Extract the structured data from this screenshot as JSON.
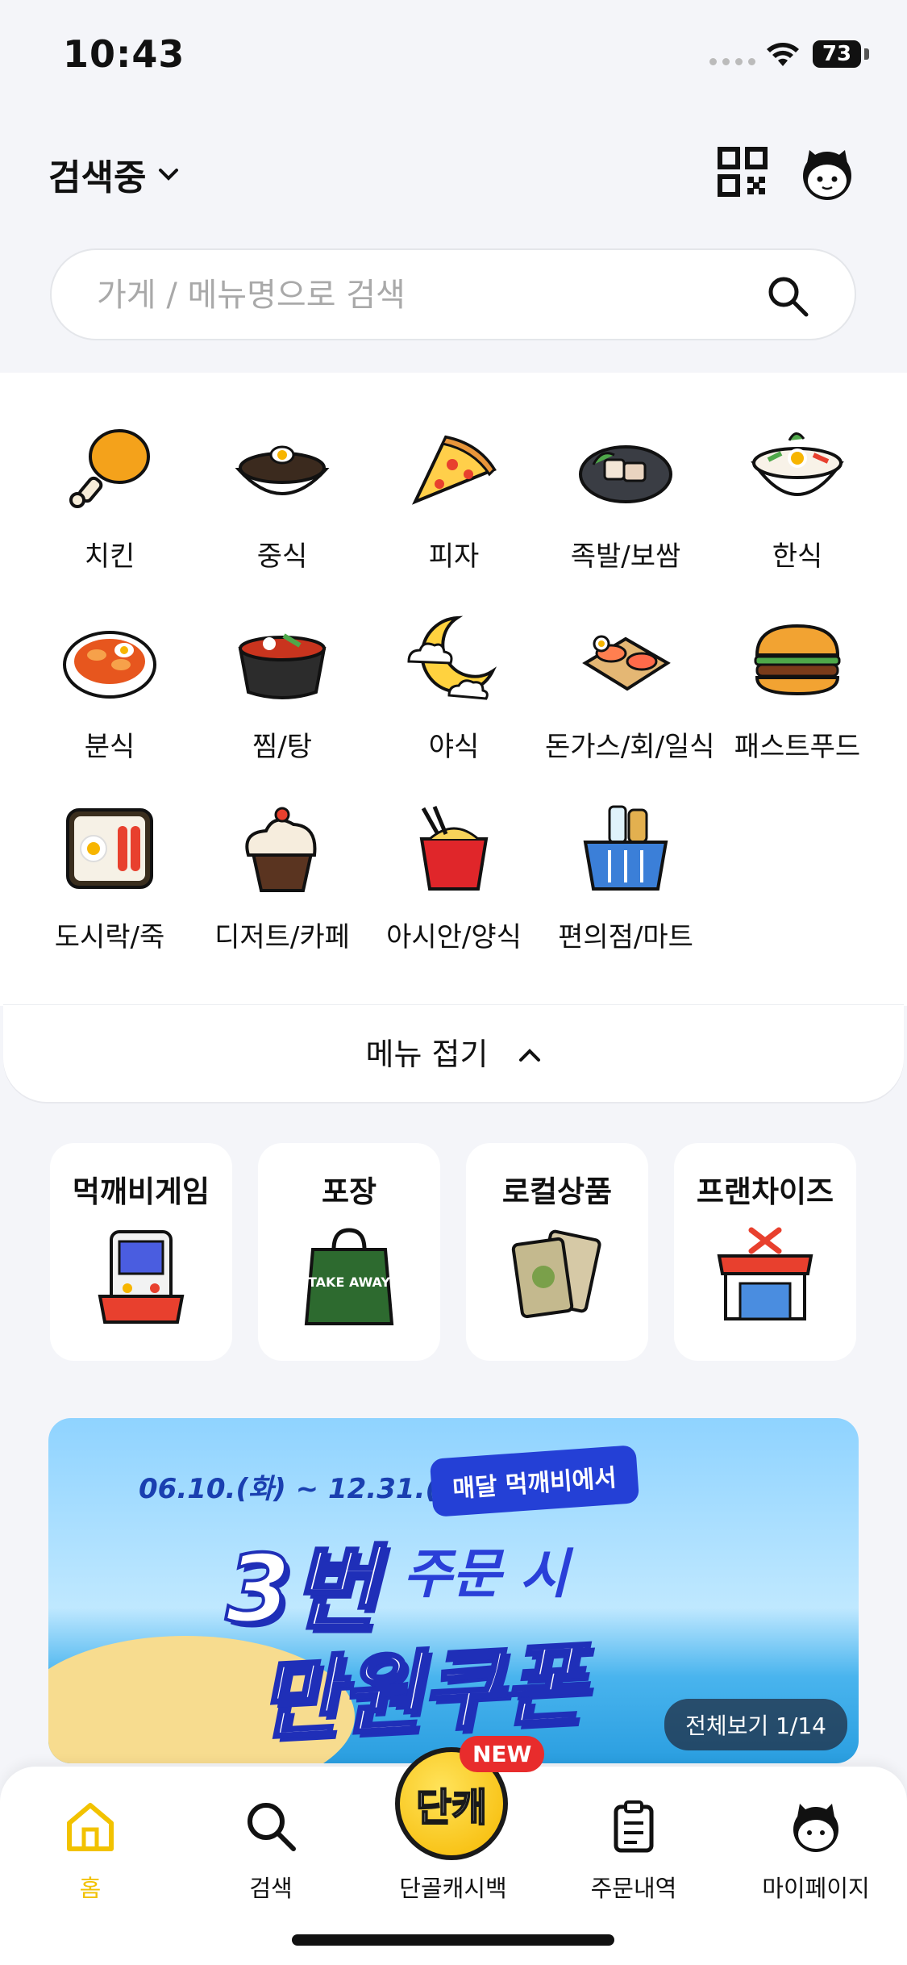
{
  "status": {
    "time": "10:43",
    "battery": "73"
  },
  "header": {
    "location": "검색중",
    "qr_icon": "qr-code-icon",
    "profile_icon": "character-face-icon"
  },
  "search": {
    "placeholder": "가게 / 메뉴명으로 검색"
  },
  "categories": [
    {
      "label": "치킨",
      "icon": "chicken-icon"
    },
    {
      "label": "중식",
      "icon": "jajangmyeon-icon"
    },
    {
      "label": "피자",
      "icon": "pizza-icon"
    },
    {
      "label": "족발/보쌈",
      "icon": "bossam-icon"
    },
    {
      "label": "한식",
      "icon": "bibimbap-icon"
    },
    {
      "label": "분식",
      "icon": "tteokbokki-icon"
    },
    {
      "label": "찜/탕",
      "icon": "stew-pot-icon"
    },
    {
      "label": "야식",
      "icon": "moon-icon"
    },
    {
      "label": "돈가스/회/일식",
      "icon": "sushi-icon"
    },
    {
      "label": "패스트푸드",
      "icon": "burger-icon"
    },
    {
      "label": "도시락/죽",
      "icon": "lunchbox-icon"
    },
    {
      "label": "디저트/카페",
      "icon": "cupcake-icon"
    },
    {
      "label": "아시안/양식",
      "icon": "noodle-box-icon"
    },
    {
      "label": "편의점/마트",
      "icon": "shopping-basket-icon"
    }
  ],
  "collapse": {
    "label": "메뉴 접기"
  },
  "quick_menu": [
    {
      "label": "먹깨비게임",
      "icon": "arcade-game-icon"
    },
    {
      "label": "포장",
      "icon": "takeaway-bag-icon",
      "bag_text": "TAKE AWAY"
    },
    {
      "label": "로컬상품",
      "icon": "local-products-icon"
    },
    {
      "label": "프랜차이즈",
      "icon": "franchise-store-icon"
    }
  ],
  "banner": {
    "date": "06.10.(화) ~ 12.31.(수)",
    "bubble": "매달 먹깨비에서",
    "big": "3번",
    "mid": "주문 시",
    "coupon": "만원쿠폰",
    "viewall": "전체보기 1/14"
  },
  "tabbar": {
    "items": [
      {
        "label": "홈",
        "icon": "home-icon"
      },
      {
        "label": "검색",
        "icon": "search-icon"
      },
      {
        "label": "단골캐시백",
        "icon": "cashback-coin-icon"
      },
      {
        "label": "주문내역",
        "icon": "clipboard-icon"
      },
      {
        "label": "마이페이지",
        "icon": "character-face-icon"
      }
    ],
    "cashback_coin": "단캐",
    "new_badge": "NEW"
  },
  "colors": {
    "accent": "#F2C200",
    "background": "#F4F5F9",
    "banner_blue": "#1F2FB8",
    "badge_red": "#E82C2C"
  }
}
